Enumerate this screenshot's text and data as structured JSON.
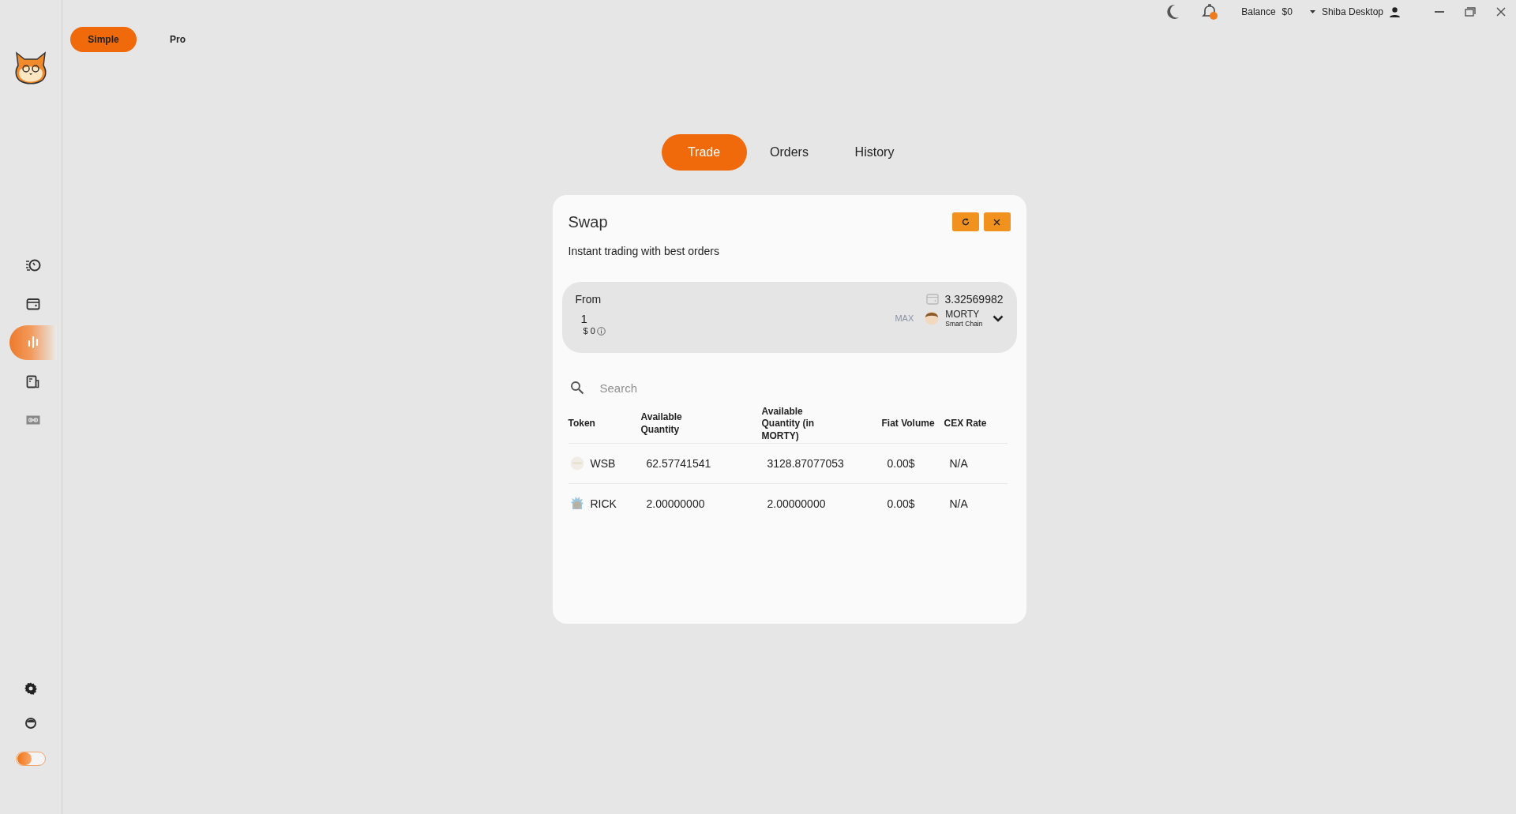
{
  "top_bar": {
    "balance_label": "Balance",
    "balance_value": "$0",
    "account": "Shiba Desktop"
  },
  "sidebar": {
    "items": [
      {
        "selected": false
      },
      {
        "selected": false
      },
      {
        "selected": true
      },
      {
        "selected": false
      },
      {
        "selected": false
      }
    ]
  },
  "theme_toggle": {
    "on": false
  },
  "mode_tabs": [
    {
      "label": "Simple",
      "selected": true
    },
    {
      "label": "Pro",
      "selected": false
    }
  ],
  "tabs": [
    {
      "label": "Trade",
      "selected": true
    },
    {
      "label": "Orders",
      "selected": false
    },
    {
      "label": "History",
      "selected": false
    }
  ],
  "swap": {
    "title": "Swap",
    "subtitle": "Instant trading with best orders",
    "from": {
      "label": "From",
      "balance": "3.32569982",
      "amount": "1",
      "fiat": "$ 0",
      "max": "MAX",
      "coin": "MORTY",
      "chain": "Smart Chain"
    },
    "search": {
      "placeholder": "Search"
    },
    "table": {
      "columns": [
        "Token",
        "Available Quantity",
        "Available Quantity (in MORTY)",
        "Fiat Volume",
        "CEX Rate"
      ],
      "rows": [
        {
          "token": "WSB",
          "available_quantity": "62.57741541",
          "available_quantity_in_coin": "3128.87077053",
          "fiat_volume": "0.00$",
          "cex_rate": "N/A"
        },
        {
          "token": "RICK",
          "available_quantity": "2.00000000",
          "available_quantity_in_coin": "2.00000000",
          "fiat_volume": "0.00$",
          "cex_rate": "N/A"
        }
      ]
    }
  }
}
